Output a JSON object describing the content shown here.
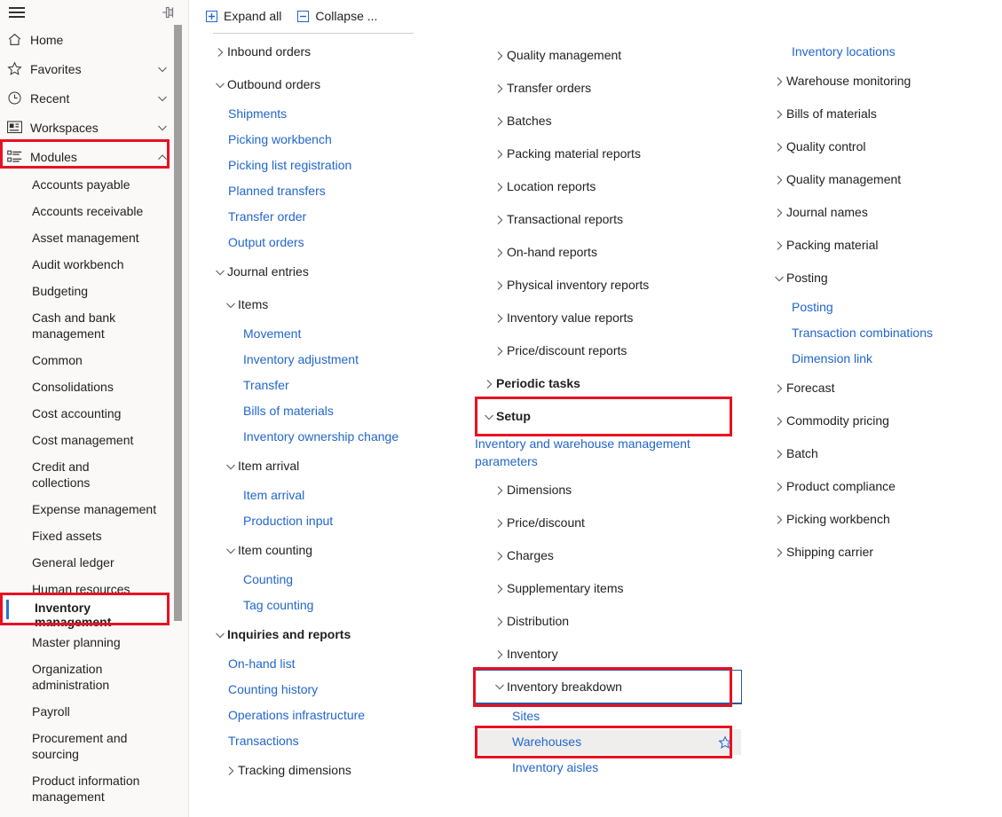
{
  "nav": {
    "hamburger_label": "hamburger-menu",
    "pin_label": "pin-navigation",
    "items": [
      {
        "label": "Home",
        "icon": "home-icon",
        "chevron": "none"
      },
      {
        "label": "Favorites",
        "icon": "star-icon",
        "chevron": "down"
      },
      {
        "label": "Recent",
        "icon": "clock-icon",
        "chevron": "down"
      },
      {
        "label": "Workspaces",
        "icon": "workspaces-icon",
        "chevron": "down"
      },
      {
        "label": "Modules",
        "icon": "modules-icon",
        "chevron": "up"
      }
    ],
    "modules": [
      "Accounts payable",
      "Accounts receivable",
      "Asset management",
      "Audit workbench",
      "Budgeting",
      "Cash and bank management",
      "Common",
      "Consolidations",
      "Cost accounting",
      "Cost management",
      "Credit and collections",
      "Expense management",
      "Fixed assets",
      "General ledger",
      "Human resources",
      "Inventory management",
      "Master planning",
      "Organization administration",
      "Payroll",
      "Procurement and sourcing",
      "Product information management"
    ],
    "selected_module": "Inventory management"
  },
  "toolbar": {
    "expand_all": "Expand all",
    "collapse_all": "Collapse ...",
    "expand_icon": "expand-all-icon",
    "collapse_icon": "collapse-all-icon"
  },
  "col1": [
    {
      "kind": "group",
      "label": "Inbound orders",
      "state": "collapsed",
      "level": 0,
      "bold": false
    },
    {
      "kind": "group",
      "label": "Outbound orders",
      "state": "expanded",
      "level": 0,
      "bold": false
    },
    {
      "kind": "link",
      "label": "Shipments",
      "level": 1
    },
    {
      "kind": "link",
      "label": "Picking workbench",
      "level": 1
    },
    {
      "kind": "link",
      "label": "Picking list registration",
      "level": 1
    },
    {
      "kind": "link",
      "label": "Planned transfers",
      "level": 1
    },
    {
      "kind": "link",
      "label": "Transfer order",
      "level": 1
    },
    {
      "kind": "link",
      "label": "Output orders",
      "level": 1
    },
    {
      "kind": "group",
      "label": "Journal entries",
      "state": "expanded",
      "level": 0,
      "bold": false
    },
    {
      "kind": "group",
      "label": "Items",
      "state": "expanded",
      "level": 1,
      "bold": false
    },
    {
      "kind": "link",
      "label": "Movement",
      "level": 2
    },
    {
      "kind": "link",
      "label": "Inventory adjustment",
      "level": 2
    },
    {
      "kind": "link",
      "label": "Transfer",
      "level": 2
    },
    {
      "kind": "link",
      "label": "Bills of materials",
      "level": 2
    },
    {
      "kind": "link",
      "label": "Inventory ownership change",
      "level": 2
    },
    {
      "kind": "group",
      "label": "Item arrival",
      "state": "expanded",
      "level": 1,
      "bold": false
    },
    {
      "kind": "link",
      "label": "Item arrival",
      "level": 2
    },
    {
      "kind": "link",
      "label": "Production input",
      "level": 2
    },
    {
      "kind": "group",
      "label": "Item counting",
      "state": "expanded",
      "level": 1,
      "bold": false
    },
    {
      "kind": "link",
      "label": "Counting",
      "level": 2
    },
    {
      "kind": "link",
      "label": "Tag counting",
      "level": 2
    },
    {
      "kind": "group",
      "label": "Inquiries and reports",
      "state": "expanded",
      "level": 0,
      "bold": true
    },
    {
      "kind": "link",
      "label": "On-hand list",
      "level": 1
    },
    {
      "kind": "link",
      "label": "Counting history",
      "level": 1
    },
    {
      "kind": "link",
      "label": "Operations infrastructure",
      "level": 1
    },
    {
      "kind": "link",
      "label": "Transactions",
      "level": 1
    },
    {
      "kind": "group",
      "label": "Tracking dimensions",
      "state": "collapsed",
      "level": 1,
      "bold": false
    }
  ],
  "col2": [
    {
      "kind": "group",
      "label": "Quality management",
      "state": "collapsed",
      "level": 1,
      "bold": false
    },
    {
      "kind": "group",
      "label": "Transfer orders",
      "state": "collapsed",
      "level": 1,
      "bold": false
    },
    {
      "kind": "group",
      "label": "Batches",
      "state": "collapsed",
      "level": 1,
      "bold": false
    },
    {
      "kind": "group",
      "label": "Packing material reports",
      "state": "collapsed",
      "level": 1,
      "bold": false
    },
    {
      "kind": "group",
      "label": "Location reports",
      "state": "collapsed",
      "level": 1,
      "bold": false
    },
    {
      "kind": "group",
      "label": "Transactional reports",
      "state": "collapsed",
      "level": 1,
      "bold": false
    },
    {
      "kind": "group",
      "label": "On-hand reports",
      "state": "collapsed",
      "level": 1,
      "bold": false
    },
    {
      "kind": "group",
      "label": "Physical inventory reports",
      "state": "collapsed",
      "level": 1,
      "bold": false
    },
    {
      "kind": "group",
      "label": "Inventory value reports",
      "state": "collapsed",
      "level": 1,
      "bold": false
    },
    {
      "kind": "group",
      "label": "Price/discount reports",
      "state": "collapsed",
      "level": 1,
      "bold": false
    },
    {
      "kind": "group",
      "label": "Periodic tasks",
      "state": "collapsed",
      "level": 0,
      "bold": true
    },
    {
      "kind": "group",
      "label": "Setup",
      "state": "expanded",
      "level": 0,
      "bold": true,
      "highlight": "red"
    },
    {
      "kind": "link",
      "label": "Inventory and warehouse management parameters",
      "level": 1,
      "multiline": true
    },
    {
      "kind": "group",
      "label": "Dimensions",
      "state": "collapsed",
      "level": 1,
      "bold": false
    },
    {
      "kind": "group",
      "label": "Price/discount",
      "state": "collapsed",
      "level": 1,
      "bold": false
    },
    {
      "kind": "group",
      "label": "Charges",
      "state": "collapsed",
      "level": 1,
      "bold": false
    },
    {
      "kind": "group",
      "label": "Supplementary items",
      "state": "collapsed",
      "level": 1,
      "bold": false
    },
    {
      "kind": "group",
      "label": "Distribution",
      "state": "collapsed",
      "level": 1,
      "bold": false
    },
    {
      "kind": "group",
      "label": "Inventory",
      "state": "collapsed",
      "level": 1,
      "bold": false
    },
    {
      "kind": "group",
      "label": "Inventory breakdown",
      "state": "expanded",
      "level": 1,
      "bold": false,
      "highlight": "red",
      "focused": true
    },
    {
      "kind": "link",
      "label": "Sites",
      "level": 2
    },
    {
      "kind": "link",
      "label": "Warehouses",
      "level": 2,
      "highlight": "red",
      "hovered": true,
      "star": true
    },
    {
      "kind": "link",
      "label": "Inventory aisles",
      "level": 2
    }
  ],
  "col3": [
    {
      "kind": "link",
      "label": "Inventory locations",
      "level": 2
    },
    {
      "kind": "group",
      "label": "Warehouse monitoring",
      "state": "collapsed",
      "level": 1,
      "bold": false
    },
    {
      "kind": "group",
      "label": "Bills of materials",
      "state": "collapsed",
      "level": 1,
      "bold": false
    },
    {
      "kind": "group",
      "label": "Quality control",
      "state": "collapsed",
      "level": 1,
      "bold": false
    },
    {
      "kind": "group",
      "label": "Quality management",
      "state": "collapsed",
      "level": 1,
      "bold": false
    },
    {
      "kind": "group",
      "label": "Journal names",
      "state": "collapsed",
      "level": 1,
      "bold": false
    },
    {
      "kind": "group",
      "label": "Packing material",
      "state": "collapsed",
      "level": 1,
      "bold": false
    },
    {
      "kind": "group",
      "label": "Posting",
      "state": "expanded",
      "level": 1,
      "bold": false
    },
    {
      "kind": "link",
      "label": "Posting",
      "level": 2
    },
    {
      "kind": "link",
      "label": "Transaction combinations",
      "level": 2
    },
    {
      "kind": "link",
      "label": "Dimension link",
      "level": 2
    },
    {
      "kind": "group",
      "label": "Forecast",
      "state": "collapsed",
      "level": 1,
      "bold": false
    },
    {
      "kind": "group",
      "label": "Commodity pricing",
      "state": "collapsed",
      "level": 1,
      "bold": false
    },
    {
      "kind": "group",
      "label": "Batch",
      "state": "collapsed",
      "level": 1,
      "bold": false
    },
    {
      "kind": "group",
      "label": "Product compliance",
      "state": "collapsed",
      "level": 1,
      "bold": false
    },
    {
      "kind": "group",
      "label": "Picking workbench",
      "state": "collapsed",
      "level": 1,
      "bold": false
    },
    {
      "kind": "group",
      "label": "Shipping carrier",
      "state": "collapsed",
      "level": 1,
      "bold": false
    }
  ],
  "colors": {
    "link": "#2266cc",
    "text": "#201f1e",
    "chevron": "#605e5c",
    "highlight_red": "#e81123",
    "focus_blue": "#2b579a",
    "accent_bar": "#2a6fd6",
    "panel_bg": "#faf9f8",
    "hover_bg": "#efeeed"
  }
}
